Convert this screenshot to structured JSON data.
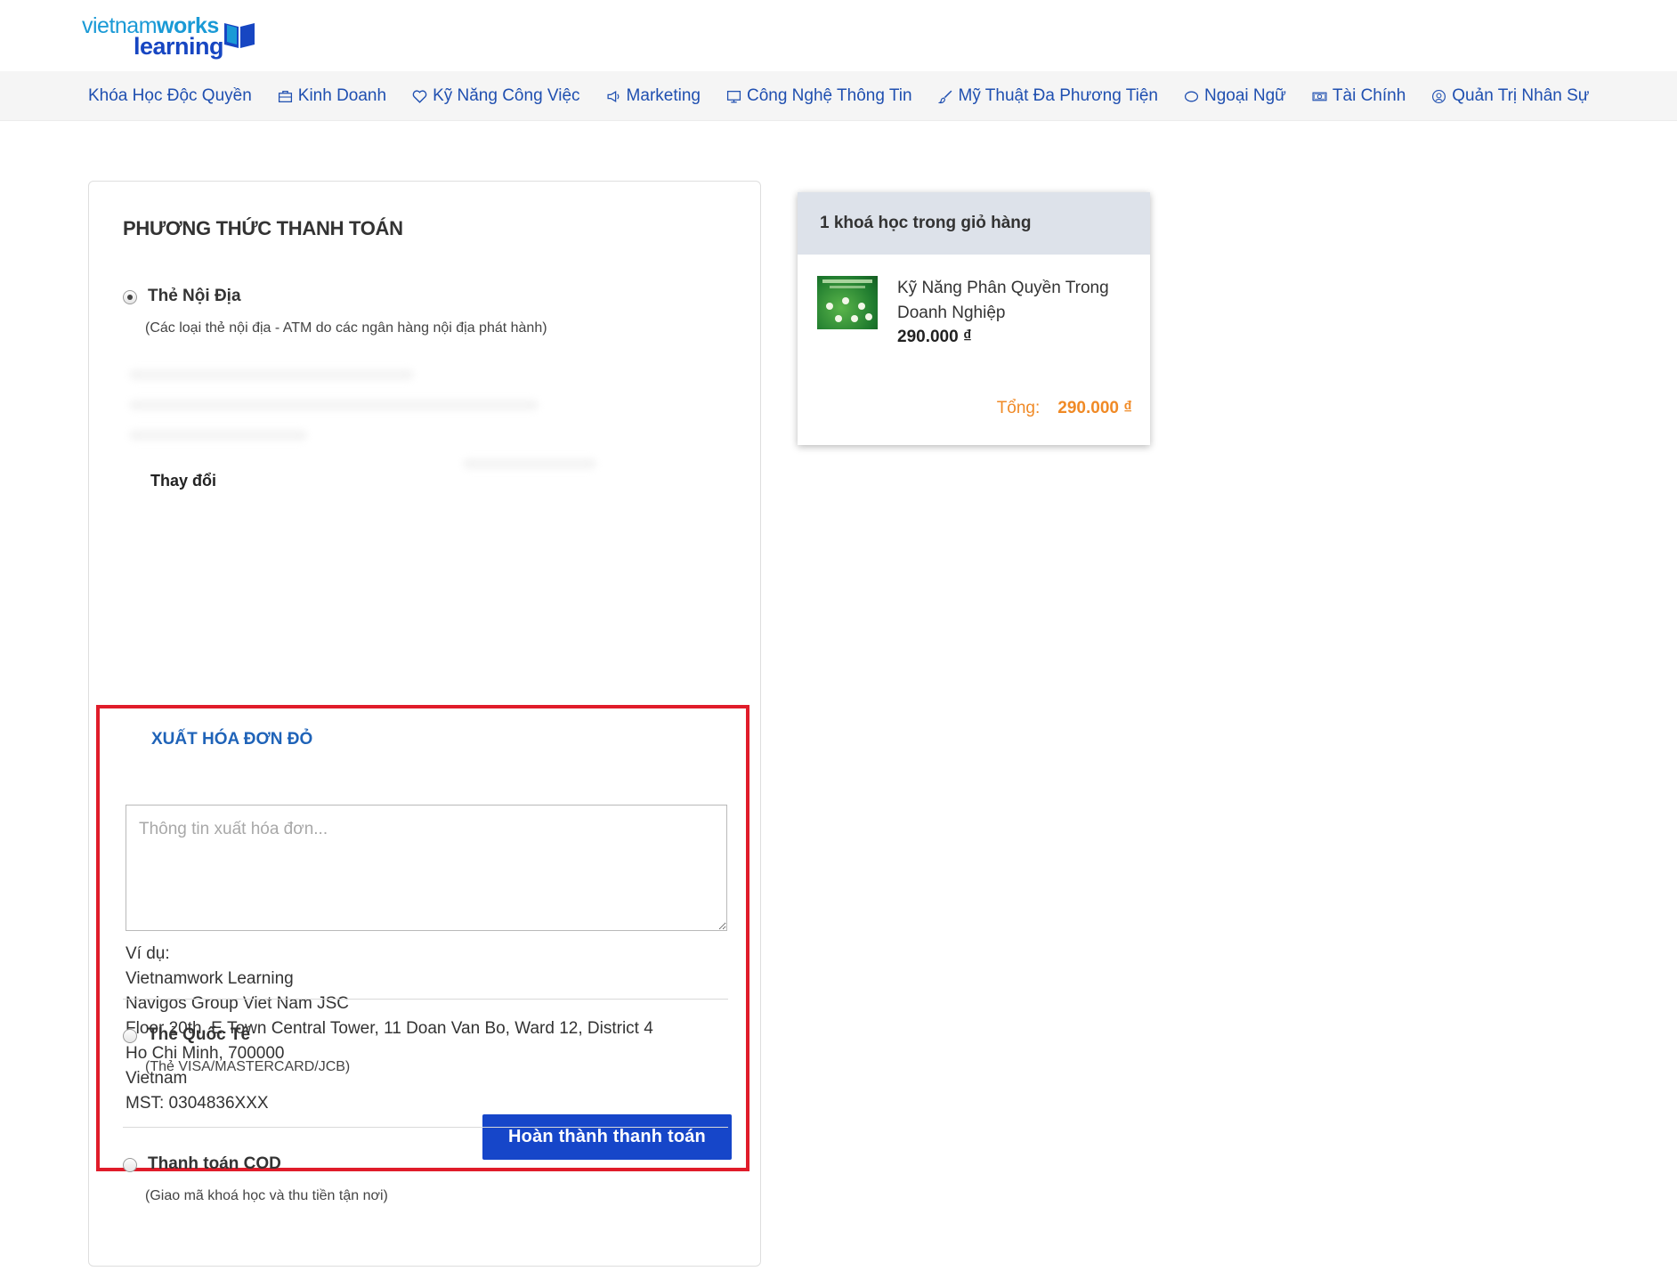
{
  "logo": {
    "line1_light": "vietnam",
    "line1_bold": "works",
    "line2": "learning"
  },
  "nav": {
    "items": [
      {
        "label": "Khóa Học Độc Quyền",
        "icon": "none"
      },
      {
        "label": "Kinh Doanh",
        "icon": "briefcase-icon"
      },
      {
        "label": "Kỹ Năng Công Việc",
        "icon": "heart-icon"
      },
      {
        "label": "Marketing",
        "icon": "megaphone-icon"
      },
      {
        "label": "Công Nghệ Thông Tin",
        "icon": "monitor-icon"
      },
      {
        "label": "Mỹ Thuật Đa Phương Tiện",
        "icon": "brush-icon"
      },
      {
        "label": "Ngoại Ngữ",
        "icon": "speech-bubble-icon"
      },
      {
        "label": "Tài Chính",
        "icon": "money-icon"
      },
      {
        "label": "Quản Trị Nhân Sự",
        "icon": "user-circle-icon"
      }
    ]
  },
  "payment": {
    "title": "PHƯƠNG THỨC THANH TOÁN",
    "options": [
      {
        "label": "Thẻ Nội Địa",
        "desc": "(Các loại thẻ nội địa - ATM do các ngân hàng nội địa phát hành)",
        "checked": true
      },
      {
        "label": "Thẻ Quốc Tế",
        "desc": "(Thẻ VISA/MASTERCARD/JCB)",
        "checked": false
      },
      {
        "label": "Thanh toán COD",
        "desc": "(Giao mã khoá học và thu tiền tận nơi)",
        "checked": false
      }
    ],
    "change_label": "Thay đổi",
    "invoice": {
      "title": "XUẤT HÓA ĐƠN ĐỎ",
      "placeholder": "Thông tin xuất hóa đơn...",
      "example_lines": [
        "Ví dụ:",
        "Vietnamwork Learning",
        "Navigos Group Viet Nam JSC",
        "Floor 20th, E.Town Central Tower, 11 Doan Van Bo, Ward 12, District 4",
        "Ho Chi Minh, 700000",
        "Vietnam",
        "MST: 0304836XXX"
      ],
      "submit_label": "Hoàn thành thanh toán"
    }
  },
  "cart": {
    "header": "1 khoá học trong giỏ hàng",
    "items": [
      {
        "name": "Kỹ Năng Phân Quyền Trong Doanh Nghiệp",
        "price": "290.000 ₫"
      }
    ],
    "total_label": "Tổng:",
    "total_value": "290.000 ₫"
  },
  "colors": {
    "nav_text": "#1f4fb0",
    "invoice_border": "#e01c2a",
    "invoice_title": "#1f63b8",
    "primary_button": "#1646c9",
    "total": "#f08a26"
  }
}
